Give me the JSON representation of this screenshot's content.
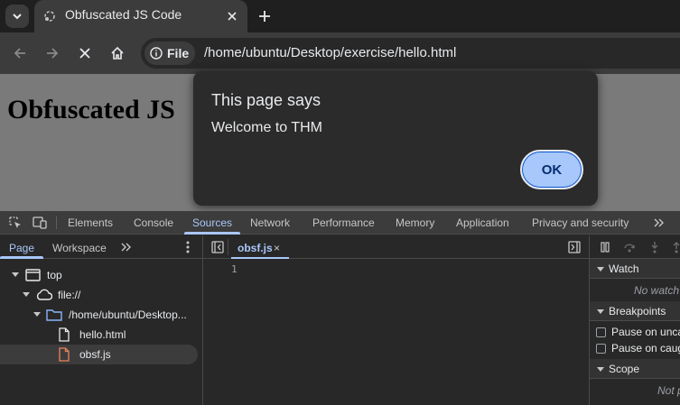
{
  "browser": {
    "tab_title": "Obfuscated JS Code",
    "site_chip_label": "File",
    "url": "/home/ubuntu/Desktop/exercise/hello.html"
  },
  "page": {
    "heading": "Obfuscated JS"
  },
  "dialog": {
    "title": "This page says",
    "message": "Welcome to THM",
    "ok_label": "OK"
  },
  "devtools": {
    "tabs": [
      "Elements",
      "Console",
      "Sources",
      "Network",
      "Performance",
      "Memory",
      "Application",
      "Privacy and security"
    ],
    "active_tab": "Sources",
    "navigator_tabs": [
      "Page",
      "Workspace"
    ],
    "active_navigator_tab": "Page",
    "tree": {
      "top": "top",
      "origin": "file://",
      "folder": "/home/ubuntu/Desktop...",
      "files": [
        "hello.html",
        "obsf.js"
      ],
      "selected_file": "obsf.js"
    },
    "editor": {
      "open_file": "obsf.js",
      "close_glyph": "×",
      "line_numbers": [
        "1"
      ]
    },
    "debugger": {
      "watch_label": "Watch",
      "watch_empty": "No watch",
      "breakpoints_label": "Breakpoints",
      "pause_uncaught": "Pause on unca",
      "pause_caught": "Pause on caug",
      "scope_label": "Scope",
      "scope_empty": "Not p"
    }
  },
  "colors": {
    "accent": "#a8c7fa",
    "page_background": "#7a7a7a",
    "dialog_background": "#2b2b2b",
    "file_icon_js": "#e8845c"
  },
  "icons": [
    "tab-search-icon",
    "favicon-icon",
    "close-icon",
    "plus-icon",
    "back-arrow-icon",
    "forward-arrow-icon",
    "stop-icon",
    "home-icon",
    "info-icon",
    "inspect-element-icon",
    "device-toggle-icon",
    "more-tabs-icon",
    "kebab-menu-icon",
    "toggle-navigator-icon",
    "toggle-debugger-icon",
    "pause-icon",
    "step-over-icon",
    "step-into-icon",
    "window-icon",
    "cloud-icon",
    "folder-icon",
    "file-icon"
  ]
}
